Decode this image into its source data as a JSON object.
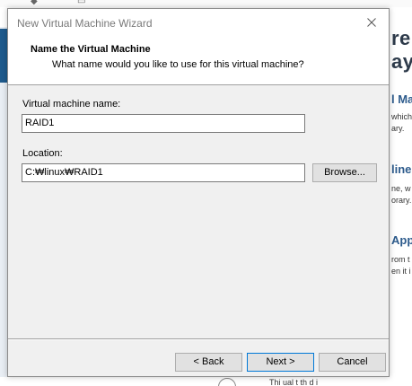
{
  "background": {
    "right_heading": "re",
    "right_heading2": "aye",
    "section1_title": "l Ma",
    "section1_line1": "which",
    "section1_line2": "ary.",
    "section2_title": "line",
    "section2_line1": "ne, w",
    "section2_line2": "orary.",
    "section3_title": "App",
    "section3_line1": "rom t",
    "section3_line2": "en it i",
    "bottom_text": "Thi   ual  t      th        d   i"
  },
  "dialog": {
    "title": "New Virtual Machine Wizard",
    "header_title": "Name the Virtual Machine",
    "header_subtitle": "What name would you like to use for this virtual machine?",
    "vm_name_label": "Virtual machine name:",
    "vm_name_value": "RAID1",
    "location_label": "Location:",
    "location_value": "C:₩linux₩RAID1",
    "browse_label": "Browse...",
    "back_label": "< Back",
    "next_label": "Next >",
    "cancel_label": "Cancel"
  },
  "icons": {
    "close": "close-icon"
  },
  "colors": {
    "title_text": "#7a7a7a",
    "dialog_bg": "#f0f0f0",
    "focus_border": "#0078d7",
    "bg_heading": "#2d5b8c"
  }
}
